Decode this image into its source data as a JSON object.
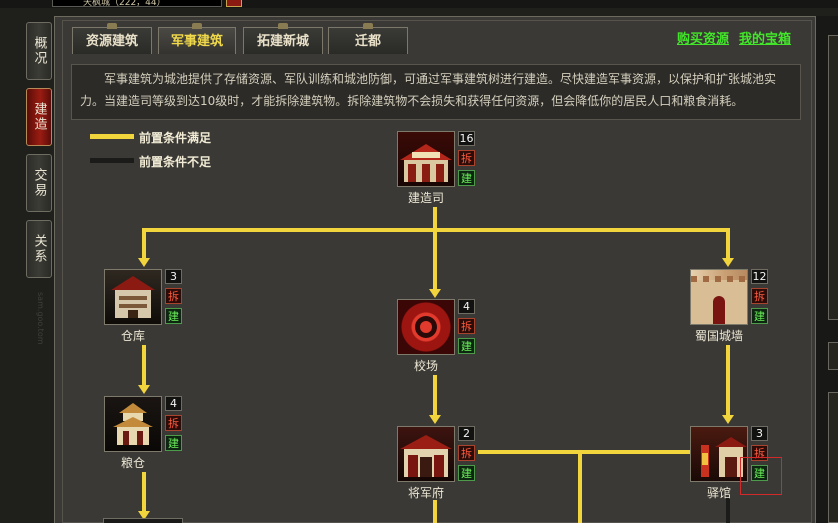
{
  "topbar": {
    "city_text": "天枫城（222，44）"
  },
  "left_nav": [
    {
      "label": "概况",
      "active": false
    },
    {
      "label": "建造",
      "active": true
    },
    {
      "label": "交易",
      "active": false
    },
    {
      "label": "关系",
      "active": false
    }
  ],
  "watermark": "sam.goo.tom",
  "tabs": [
    {
      "label": "资源建筑",
      "active": false
    },
    {
      "label": "军事建筑",
      "active": true
    },
    {
      "label": "拓建新城",
      "active": false
    },
    {
      "label": "迁都",
      "active": false
    }
  ],
  "links": {
    "buy_resources": "购买资源",
    "my_treasure": "我的宝箱"
  },
  "description": "军事建筑为城池提供了存储资源、军队训练和城池防御，可通过军事建筑树进行建造。尽快建造军事资源，以保护和扩张城池实力。当建造司等级到达10级时，才能拆除建筑物。拆除建筑物不会损失和获得任何资源，但会降低你的居民人口和粮食消耗。",
  "legend": [
    {
      "label": "前置条件满足",
      "color": "#f2d43c"
    },
    {
      "label": "前置条件不足",
      "color": "#1b1b1a"
    }
  ],
  "colors": {
    "line_met": "#f2d43c",
    "demolish_red": "#ff5a3c",
    "build_green": "#6cf05a",
    "link_green": "#43e52a",
    "active_tab": "#f0d94a"
  },
  "buildings": {
    "jianzaosi": {
      "name": "建造司",
      "level": "16",
      "demolish": "拆",
      "build": "建",
      "icon": "building-icon"
    },
    "cangku": {
      "name": "仓库",
      "level": "3",
      "demolish": "拆",
      "build": "建",
      "icon": "warehouse-icon"
    },
    "jiaochang": {
      "name": "校场",
      "level": "4",
      "demolish": "拆",
      "build": "建",
      "icon": "training-ground-icon"
    },
    "chengqiang": {
      "name": "蜀国城墙",
      "level": "12",
      "demolish": "拆",
      "build": "建",
      "icon": "city-wall-icon"
    },
    "liangcang": {
      "name": "粮仓",
      "level": "4",
      "demolish": "拆",
      "build": "建",
      "icon": "granary-icon"
    },
    "jiangjunfu": {
      "name": "将军府",
      "level": "2",
      "demolish": "拆",
      "build": "建",
      "icon": "general-mansion-icon"
    },
    "yiguan": {
      "name": "驿馆",
      "level": "3",
      "demolish": "拆",
      "build": "建",
      "icon": "inn-icon"
    }
  }
}
